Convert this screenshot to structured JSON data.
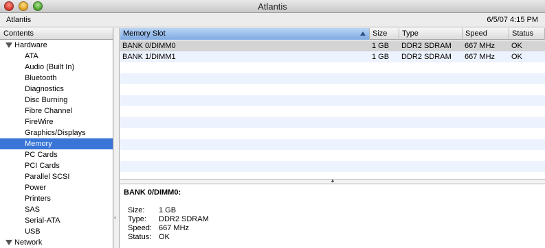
{
  "window": {
    "title": "Atlantis"
  },
  "info": {
    "machine": "Atlantis",
    "datetime": "6/5/07 4:15 PM"
  },
  "sidebar": {
    "header": "Contents",
    "groups": [
      {
        "label": "Hardware",
        "items": [
          {
            "label": "ATA"
          },
          {
            "label": "Audio (Built In)"
          },
          {
            "label": "Bluetooth"
          },
          {
            "label": "Diagnostics"
          },
          {
            "label": "Disc Burning"
          },
          {
            "label": "Fibre Channel"
          },
          {
            "label": "FireWire"
          },
          {
            "label": "Graphics/Displays"
          },
          {
            "label": "Memory",
            "selected": true
          },
          {
            "label": "PC Cards"
          },
          {
            "label": "PCI Cards"
          },
          {
            "label": "Parallel SCSI"
          },
          {
            "label": "Power"
          },
          {
            "label": "Printers"
          },
          {
            "label": "SAS"
          },
          {
            "label": "Serial-ATA"
          },
          {
            "label": "USB"
          }
        ]
      },
      {
        "label": "Network",
        "items": []
      }
    ]
  },
  "table": {
    "columns": [
      {
        "label": "Memory Slot",
        "sorted": true
      },
      {
        "label": "Size"
      },
      {
        "label": "Type"
      },
      {
        "label": "Speed"
      },
      {
        "label": "Status"
      }
    ],
    "rows": [
      {
        "cells": [
          "BANK 0/DIMM0",
          "1 GB",
          "DDR2 SDRAM",
          "667 MHz",
          "OK"
        ],
        "selected": true
      },
      {
        "cells": [
          "BANK 1/DIMM1",
          "1 GB",
          "DDR2 SDRAM",
          "667 MHz",
          "OK"
        ]
      }
    ]
  },
  "detail": {
    "title": "BANK 0/DIMM0:",
    "fields": [
      {
        "label": "Size:",
        "value": "1 GB"
      },
      {
        "label": "Type:",
        "value": "DDR2 SDRAM"
      },
      {
        "label": "Speed:",
        "value": "667 MHz"
      },
      {
        "label": "Status:",
        "value": "OK"
      }
    ]
  }
}
